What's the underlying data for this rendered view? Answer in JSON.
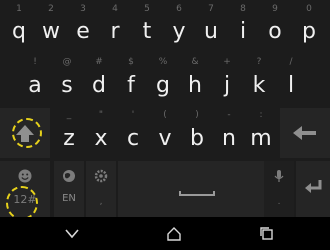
{
  "row1": [
    {
      "hint": "1",
      "key": "q"
    },
    {
      "hint": "2",
      "key": "w"
    },
    {
      "hint": "3",
      "key": "e"
    },
    {
      "hint": "4",
      "key": "r"
    },
    {
      "hint": "5",
      "key": "t"
    },
    {
      "hint": "6",
      "key": "y"
    },
    {
      "hint": "7",
      "key": "u"
    },
    {
      "hint": "8",
      "key": "i"
    },
    {
      "hint": "9",
      "key": "o"
    },
    {
      "hint": "0",
      "key": "p"
    }
  ],
  "row2": [
    {
      "hint": "!",
      "key": "a"
    },
    {
      "hint": "@",
      "key": "s"
    },
    {
      "hint": "#",
      "key": "d"
    },
    {
      "hint": "$",
      "key": "f"
    },
    {
      "hint": "%",
      "key": "g"
    },
    {
      "hint": "&",
      "key": "h"
    },
    {
      "hint": "+",
      "key": "j"
    },
    {
      "hint": "?",
      "key": "k"
    },
    {
      "hint": "/",
      "key": "l"
    }
  ],
  "row3": [
    {
      "hint": "_",
      "key": "z"
    },
    {
      "hint": "\"",
      "key": "x"
    },
    {
      "hint": "'",
      "key": "c"
    },
    {
      "hint": "(",
      "key": "v"
    },
    {
      "hint": ")",
      "key": "b"
    },
    {
      "hint": "-",
      "key": "n"
    },
    {
      "hint": ":",
      "key": "m"
    }
  ],
  "bottom": {
    "symbols_label": "12#",
    "language_label": "EN"
  },
  "colors": {
    "highlight": "#e6d11b",
    "keyboard_bg": "#1c1c1c",
    "function_key_bg": "#252525"
  }
}
